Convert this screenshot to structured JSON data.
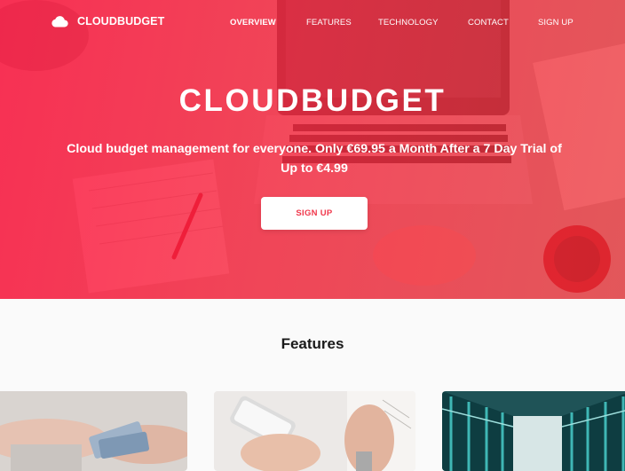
{
  "brand": {
    "name": "CLOUDBUDGET",
    "icon": "cloud-icon"
  },
  "nav": {
    "items": [
      {
        "label": "OVERVIEW",
        "active": true
      },
      {
        "label": "FEATURES",
        "active": false
      },
      {
        "label": "TECHNOLOGY",
        "active": false
      },
      {
        "label": "CONTACT",
        "active": false
      },
      {
        "label": "SIGN UP",
        "active": false
      }
    ]
  },
  "hero": {
    "title": "CLOUDBUDGET",
    "subtitle": "Cloud budget management for everyone. Only €69.95 a Month After a 7 Day Trial of Up to €4.99",
    "cta_label": "SIGN UP"
  },
  "features": {
    "title": "Features",
    "cards": [
      {
        "image": "money-in-hands-photo"
      },
      {
        "image": "phone-in-hands-photo"
      },
      {
        "image": "server-corridor-photo"
      }
    ]
  },
  "colors": {
    "accent": "#f0384c",
    "overlay": "#ff1842",
    "background": "#fafafa"
  }
}
